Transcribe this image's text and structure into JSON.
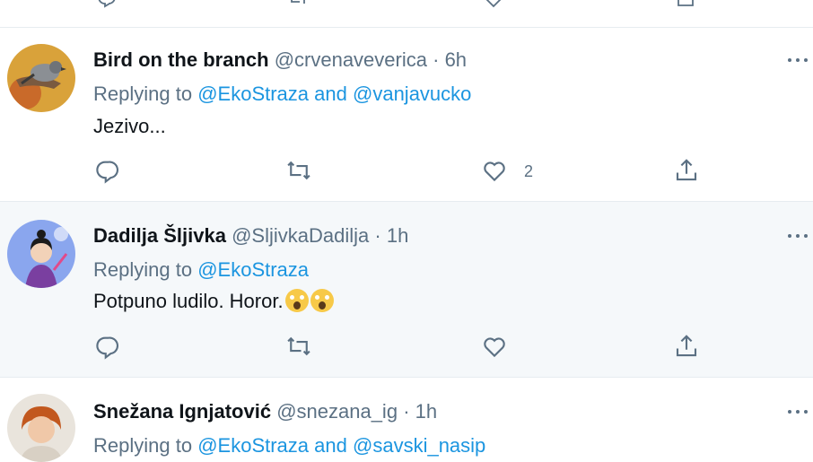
{
  "colors": {
    "accent": "#1b95e0",
    "secondary_text": "#5b7083",
    "divider": "#e6ecf0",
    "highlight_bg": "#f5f8fa"
  },
  "tweets": [
    {
      "name": "Bird on the branch",
      "handle": "@crvenaveverica",
      "separator": "·",
      "time": "6h",
      "replying_prefix": "Replying to",
      "mentions": [
        "@EkoStraza",
        "@vanjavucko"
      ],
      "and": "and",
      "text": "Jezivo...",
      "like_count": "2",
      "avatar_icon": "bird-avatar-icon"
    },
    {
      "name": "Dadilja Šljivka",
      "handle": "@SljivkaDadilja",
      "separator": "·",
      "time": "1h",
      "replying_prefix": "Replying to",
      "mentions": [
        "@EkoStraza"
      ],
      "text": "Potpuno ludilo. Horor.",
      "emoji": "screaming-face-icon",
      "avatar_icon": "cartoon-girl-avatar-icon"
    },
    {
      "name": "Snežana Ignjatović",
      "handle": "@snezana_ig",
      "separator": "·",
      "time": "1h",
      "replying_prefix": "Replying to",
      "mentions": [
        "@EkoStraza",
        "@savski_nasip"
      ],
      "and": "and",
      "avatar_icon": "user-photo-avatar-icon"
    }
  ]
}
